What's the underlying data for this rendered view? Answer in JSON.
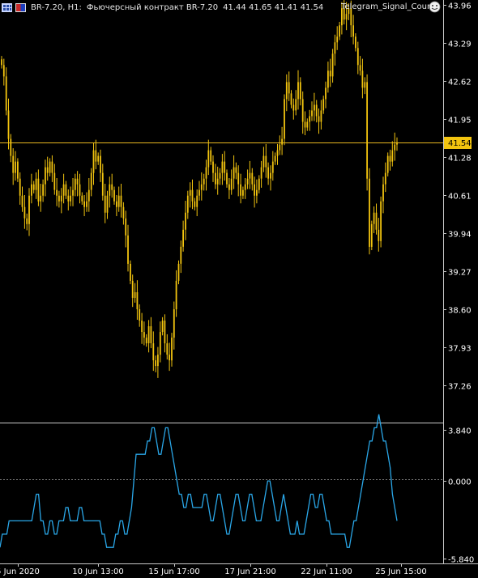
{
  "header": {
    "symbol_timeframe": "BR-7.20, H1:",
    "description": "Фьючерсный контракт BR-7.20",
    "ohlc": "41.44 41.65 41.41 41.54",
    "ea_name": "Telegram_Signal_Count"
  },
  "icons": {
    "chart_icon": "grid-chart-icon",
    "flag_icon": "flag-icon",
    "ea_icon": "smiley-ea-icon"
  },
  "colors": {
    "background": "#000000",
    "candles": "#f2c40f",
    "bid_line": "#e8b820",
    "indicator": "#2aa7e8",
    "axis": "#c8c8c8",
    "text": "#ffffff",
    "current_price_bg": "#f2c40f"
  },
  "price_axis": {
    "ticks": [
      "43.96",
      "43.29",
      "42.62",
      "41.95",
      "41.28",
      "40.61",
      "39.94",
      "39.27",
      "38.60",
      "37.93",
      "37.26"
    ],
    "current_price": "41.54"
  },
  "indicator_axis": {
    "ticks": [
      "3.840",
      "0.000",
      "-5.840"
    ]
  },
  "time_axis": {
    "ticks": [
      "5 Jun 2020",
      "10 Jun 13:00",
      "15 Jun 17:00",
      "17 Jun 21:00",
      "22 Jun 11:00",
      "25 Jun 15:00"
    ]
  },
  "chart_data": [
    {
      "type": "candlestick",
      "title": "BR-7.20, H1",
      "ylim": [
        36.86,
        44.16
      ],
      "close": [
        42.9,
        42.7,
        42.1,
        41.6,
        41.3,
        41.0,
        41.2,
        40.9,
        40.6,
        40.4,
        40.2,
        40.1,
        40.6,
        40.8,
        40.7,
        40.9,
        40.5,
        40.6,
        40.8,
        41.1,
        41.0,
        41.2,
        41.0,
        40.7,
        40.6,
        40.5,
        40.6,
        40.8,
        40.6,
        40.5,
        40.6,
        40.7,
        40.9,
        40.8,
        40.6,
        40.5,
        40.4,
        40.5,
        40.7,
        41.0,
        41.4,
        41.2,
        41.3,
        41.0,
        40.6,
        40.3,
        40.6,
        40.8,
        40.7,
        40.5,
        40.4,
        40.6,
        40.4,
        40.2,
        39.9,
        39.4,
        39.1,
        38.8,
        38.9,
        38.6,
        38.4,
        38.2,
        38.1,
        38.0,
        38.3,
        38.0,
        37.7,
        37.6,
        37.8,
        38.2,
        38.4,
        38.0,
        37.8,
        37.7,
        38.1,
        38.6,
        39.1,
        39.4,
        39.7,
        40.0,
        40.3,
        40.6,
        40.7,
        40.5,
        40.4,
        40.6,
        40.7,
        40.8,
        40.9,
        41.1,
        41.4,
        41.2,
        41.0,
        40.8,
        40.9,
        41.0,
        41.2,
        41.0,
        40.8,
        40.7,
        40.9,
        41.1,
        41.0,
        40.8,
        40.6,
        40.7,
        40.8,
        40.9,
        41.0,
        40.8,
        40.6,
        40.7,
        40.9,
        41.1,
        41.3,
        41.1,
        40.9,
        41.0,
        41.2,
        41.3,
        41.4,
        41.5,
        41.6,
        42.3,
        42.6,
        42.4,
        42.2,
        42.1,
        42.3,
        42.6,
        42.3,
        41.9,
        41.8,
        41.9,
        42.0,
        42.1,
        42.2,
        42.0,
        41.9,
        42.1,
        42.3,
        42.5,
        42.8,
        42.7,
        43.1,
        43.3,
        43.4,
        43.6,
        43.9,
        43.7,
        43.8,
        43.9,
        43.6,
        43.4,
        43.2,
        42.9,
        42.8,
        42.5,
        42.6,
        40.9,
        39.7,
        40.1,
        40.3,
        40.0,
        39.8,
        40.5,
        40.8,
        41.0,
        41.3,
        41.2,
        41.4,
        41.5,
        41.54
      ],
      "annotations": [
        "41.54"
      ]
    },
    {
      "type": "line",
      "title": "Telegram_Signal_Count",
      "ylim": [
        -5.84,
        3.84
      ],
      "reference_line": 0.0,
      "values": [
        -5,
        -4,
        -4,
        -4,
        -3,
        -3,
        -3,
        -3,
        -3,
        -3,
        -3,
        -3,
        -3,
        -3,
        -3,
        -2,
        -1,
        -1,
        -3,
        -3,
        -4,
        -4,
        -3,
        -3,
        -4,
        -4,
        -3,
        -3,
        -3,
        -2,
        -2,
        -3,
        -3,
        -3,
        -3,
        -2,
        -2,
        -3,
        -3,
        -3,
        -3,
        -3,
        -3,
        -3,
        -3,
        -4,
        -4,
        -5,
        -5,
        -5,
        -5,
        -4,
        -4,
        -3,
        -3,
        -4,
        -4,
        -3,
        -2,
        0,
        2,
        2,
        2,
        2,
        2,
        3,
        3,
        4,
        4,
        3,
        2,
        2,
        3,
        4,
        4,
        3,
        2,
        1,
        0,
        -1,
        -1,
        -2,
        -2,
        -1,
        -1,
        -2,
        -2,
        -2,
        -2,
        -2,
        -1,
        -1,
        -2,
        -3,
        -3,
        -2,
        -1,
        -1,
        -2,
        -3,
        -4,
        -4,
        -3,
        -2,
        -1,
        -1,
        -2,
        -3,
        -3,
        -2,
        -1,
        -1,
        -2,
        -3,
        -3,
        -3,
        -2,
        -1,
        0,
        0,
        -1,
        -2,
        -3,
        -3,
        -2,
        -1,
        -2,
        -3,
        -4,
        -4,
        -4,
        -3,
        -4,
        -4,
        -4,
        -3,
        -2,
        -1,
        -1,
        -2,
        -2,
        -1,
        -1,
        -2,
        -3,
        -3,
        -4,
        -4,
        -4,
        -4,
        -4,
        -4,
        -4,
        -5,
        -5,
        -4,
        -3,
        -3,
        -2,
        -1,
        0,
        1,
        2,
        3,
        3,
        4,
        4,
        5,
        4,
        3,
        3,
        2,
        1,
        -1,
        -2,
        -3
      ]
    }
  ]
}
